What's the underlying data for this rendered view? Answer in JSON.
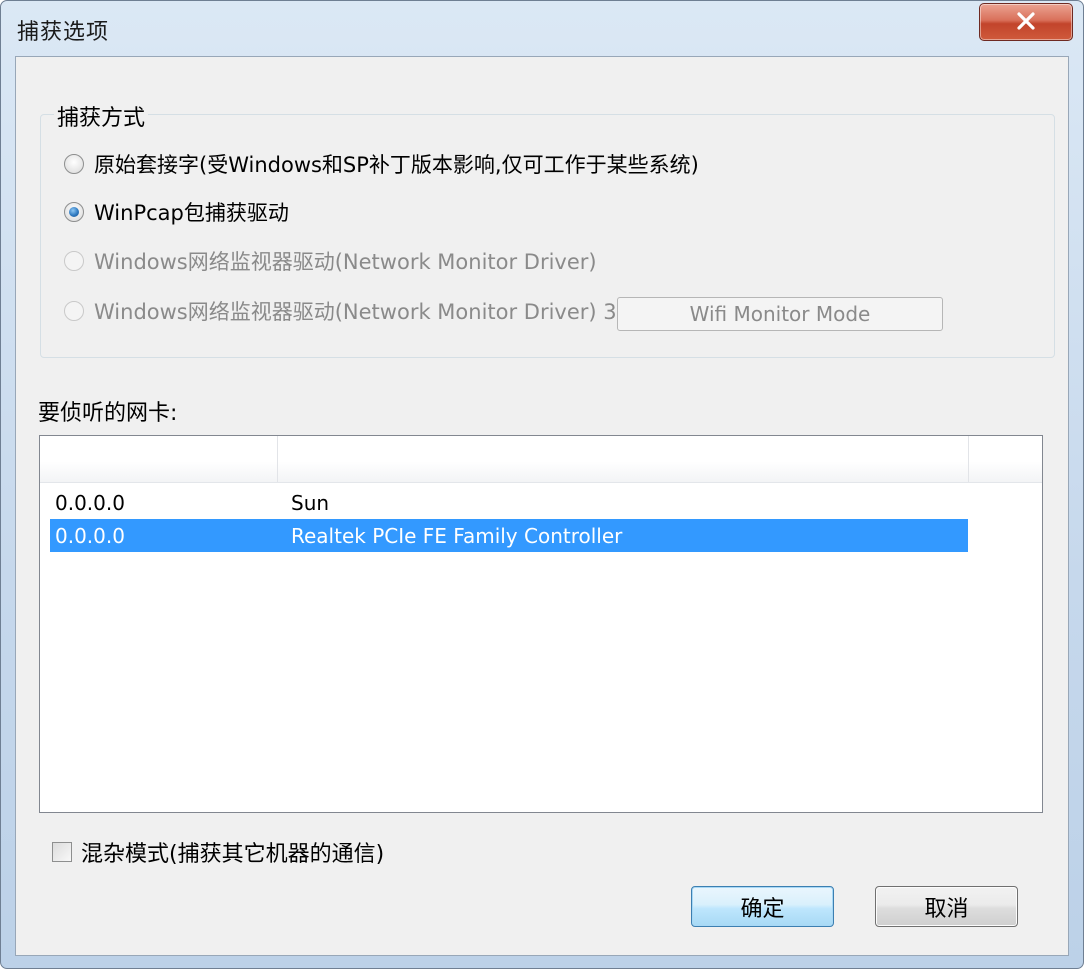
{
  "window": {
    "title": "捕获选项",
    "close_icon": "close-icon"
  },
  "capture_mode": {
    "group_label": "捕获方式",
    "options": [
      {
        "label": "原始套接字(受Windows和SP补丁版本影响,仅可工作于某些系统)",
        "checked": false,
        "enabled": true
      },
      {
        "label": "WinPcap包捕获驱动",
        "checked": true,
        "enabled": true
      },
      {
        "label": "Windows网络监视器驱动(Network Monitor Driver)",
        "checked": false,
        "enabled": false
      },
      {
        "label": "Windows网络监视器驱动(Network Monitor Driver) 3",
        "checked": false,
        "enabled": false
      }
    ],
    "wifi_button_label": "Wifi Monitor Mode"
  },
  "adapters": {
    "label": "要侦听的网卡:",
    "columns": [
      "",
      "",
      ""
    ],
    "rows": [
      {
        "ip": "0.0.0.0",
        "name": "Sun",
        "selected": false
      },
      {
        "ip": "0.0.0.0",
        "name": "Realtek PCIe FE Family Controller",
        "selected": true
      }
    ]
  },
  "promiscuous": {
    "label": "混杂模式(捕获其它机器的通信)",
    "checked": false
  },
  "buttons": {
    "ok_label": "确定",
    "cancel_label": "取消"
  },
  "colors": {
    "selection": "#3399ff",
    "title_bar": "#c6d8ec",
    "close_button": "#c2442b",
    "client_bg": "#f0f0f0"
  }
}
